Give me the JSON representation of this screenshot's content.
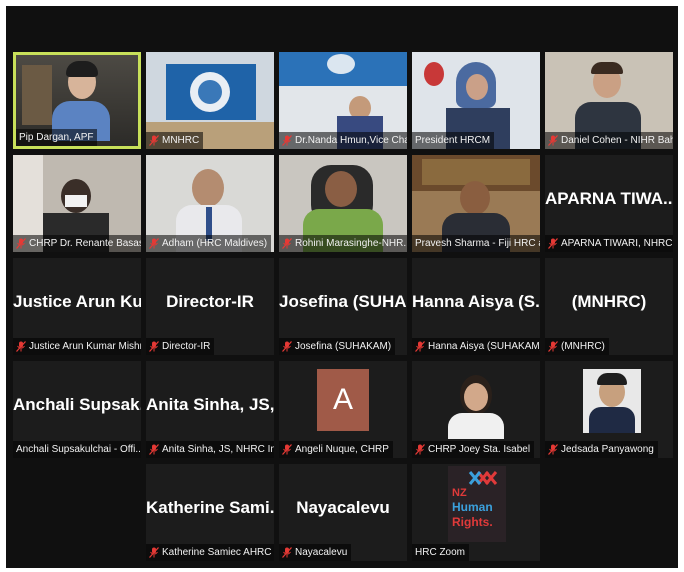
{
  "participants": [
    {
      "name": "Pip Dargan, APF",
      "muted": false,
      "active": true
    },
    {
      "name": "MNHRC",
      "muted": true
    },
    {
      "name": "Dr.Nanda Hmun,Vice Cha...",
      "muted": true
    },
    {
      "name": "President HRCM",
      "muted": false
    },
    {
      "name": "Daniel Cohen - NIHR Bah...",
      "muted": true
    },
    {
      "name": "CHRP Dr. Renante Basas",
      "muted": true
    },
    {
      "name": "Adham (HRC Maldives)",
      "muted": true
    },
    {
      "name": "Rohini Marasinghe-NHR...",
      "muted": true
    },
    {
      "name": "Pravesh Sharma - Fiji HRC a...",
      "muted": false
    },
    {
      "name": "APARNA TIWARI, NHRC I...",
      "muted": true,
      "display": "APARNA TIWA..."
    },
    {
      "name": "Justice Arun Kumar Mishr...",
      "muted": true,
      "display": "Justice Arun Ku..."
    },
    {
      "name": "Director-IR",
      "muted": true,
      "display": "Director-IR"
    },
    {
      "name": "Josefina (SUHAKAM)",
      "muted": true,
      "display": "Josefina (SUHA..."
    },
    {
      "name": "Hanna Aisya (SUHAKAM)",
      "muted": true,
      "display": "Hanna Aisya (S..."
    },
    {
      "name": "(MNHRC)",
      "muted": true,
      "display": "(MNHRC)"
    },
    {
      "name": "Anchali Supsakulchai - Offi...",
      "muted": false,
      "display": "Anchali Supsak..."
    },
    {
      "name": "Anita Sinha, JS, NHRC Ind...",
      "muted": true,
      "display": "Anita Sinha, JS,..."
    },
    {
      "name": "Angeli Nuque, CHRP",
      "muted": true,
      "avatar_letter": "A"
    },
    {
      "name": "CHRP Joey Sta. Isabel",
      "muted": true
    },
    {
      "name": "Jedsada Panyawong",
      "muted": true
    },
    {
      "name": "",
      "hidden": true
    },
    {
      "name": "Katherine Samiec AHRC",
      "muted": true,
      "display": "Katherine Sami..."
    },
    {
      "name": "Nayacalevu",
      "muted": true,
      "display": "Nayacalevu"
    },
    {
      "name": "HRC Zoom",
      "muted": false,
      "logo_text": [
        "NZ",
        "Human",
        "Rights."
      ]
    },
    {
      "name": "",
      "hidden": true
    }
  ],
  "colors": {
    "active_border": "#c8e05a",
    "muted_icon": "#e53935",
    "avatar_bg": "#a05a48"
  }
}
